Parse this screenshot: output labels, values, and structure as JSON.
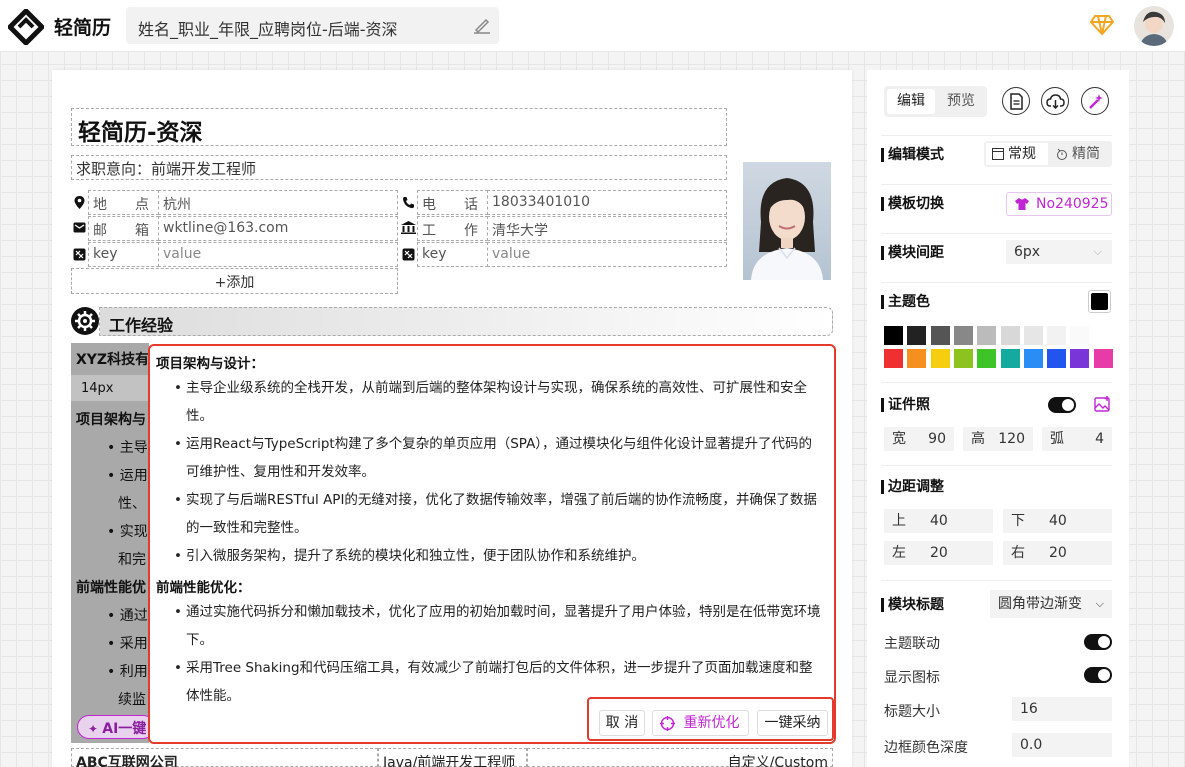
{
  "app": {
    "brand": "轻简历",
    "filename": "姓名_职业_年限_应聘岗位-后端-资深"
  },
  "resume": {
    "title": "轻简历-资深",
    "intent": "求职意向：前端开发工程师",
    "info": [
      {
        "label": "地　　点",
        "value": "杭州",
        "icon": "location-icon"
      },
      {
        "label": "电　　话",
        "value": "18033401010",
        "icon": "phone-icon"
      },
      {
        "label": "邮　　箱",
        "value": "wktline@163.com",
        "icon": "mail-icon"
      },
      {
        "label": "工　　作",
        "value": "清华大学",
        "icon": "building-icon"
      },
      {
        "label": "key",
        "value": "value",
        "icon": "custom-icon"
      },
      {
        "label": "key",
        "value": "value",
        "icon": "custom-icon"
      }
    ],
    "add_label": "+添加",
    "section_title": "工作经验",
    "company_partial": "XYZ科技有",
    "font_size_partial": "14px",
    "bg_lines": [
      "项目架构与",
      "• 主导",
      "• 运用",
      "性、",
      "• 实现",
      "和完",
      "前端性能优",
      "• 通过",
      "• 采用",
      "• 利用",
      "续监"
    ],
    "ai_partial": "AI一键",
    "bottom": {
      "company": "ABC互联网公司",
      "position": "Java/前端开发工程师",
      "custom": "自定义/Custom"
    }
  },
  "popup": {
    "groups": [
      {
        "heading": "项目架构与设计：",
        "items": [
          "主导企业级系统的全栈开发，从前端到后端的整体架构设计与实现，确保系统的高效性、可扩展性和安全性。",
          "运用React与TypeScript构建了多个复杂的单页应用（SPA），通过模块化与组件化设计显著提升了代码的可维护性、复用性和开发效率。",
          "实现了与后端RESTful API的无缝对接，优化了数据传输效率，增强了前后端的协作流畅度，并确保了数据的一致性和完整性。",
          "引入微服务架构，提升了系统的模块化和独立性，便于团队协作和系统维护。"
        ]
      },
      {
        "heading": "前端性能优化：",
        "items": [
          "通过实施代码拆分和懒加载技术，优化了应用的初始加载时间，显著提升了用户体验，特别是在低带宽环境下。",
          "采用Tree Shaking和代码压缩工具，有效减少了前端打包后的文件体积，进一步提升了页面加载速度和整体性能。"
        ]
      }
    ],
    "cancel": "取 消",
    "reoptimize": "重新优化",
    "accept": "一键采纳"
  },
  "panel": {
    "tabs": [
      "编辑",
      "预览"
    ],
    "edit_mode": {
      "label": "编辑模式",
      "options": [
        "常规",
        "精简"
      ]
    },
    "template": {
      "label": "模板切换",
      "value": "No240925"
    },
    "spacing": {
      "label": "模块间距",
      "value": "6px"
    },
    "theme": {
      "label": "主题色",
      "selected": "#000000",
      "row1": [
        "#000000",
        "#222222",
        "#555555",
        "#888888",
        "#bbbbbb",
        "#d8d8d8",
        "#e6e6e6",
        "#f2f2f2",
        "#fafafa"
      ],
      "row2": [
        "#ef3030",
        "#f5901e",
        "#f5cf0f",
        "#8cc31e",
        "#3ec427",
        "#15aaa0",
        "#2a8cf5",
        "#2255ee",
        "#7a35d9",
        "#e73ba8"
      ]
    },
    "photo": {
      "label": "证件照",
      "w_label": "宽",
      "w": "90",
      "h_label": "高",
      "h": "120",
      "r_label": "弧",
      "r": "4"
    },
    "margin": {
      "label": "边距调整",
      "top_label": "上",
      "top": "40",
      "bottom_label": "下",
      "bottom": "40",
      "left_label": "左",
      "left": "20",
      "right_label": "右",
      "right": "20"
    },
    "module_title": {
      "label": "模块标题",
      "value": "圆角带边渐变"
    },
    "theme_link": "主题联动",
    "show_icon": "显示图标",
    "title_size": {
      "label": "标题大小",
      "value": "16"
    },
    "border_depth": {
      "label": "边框颜色深度",
      "value": "0.0"
    },
    "accent": "#c026d3"
  }
}
